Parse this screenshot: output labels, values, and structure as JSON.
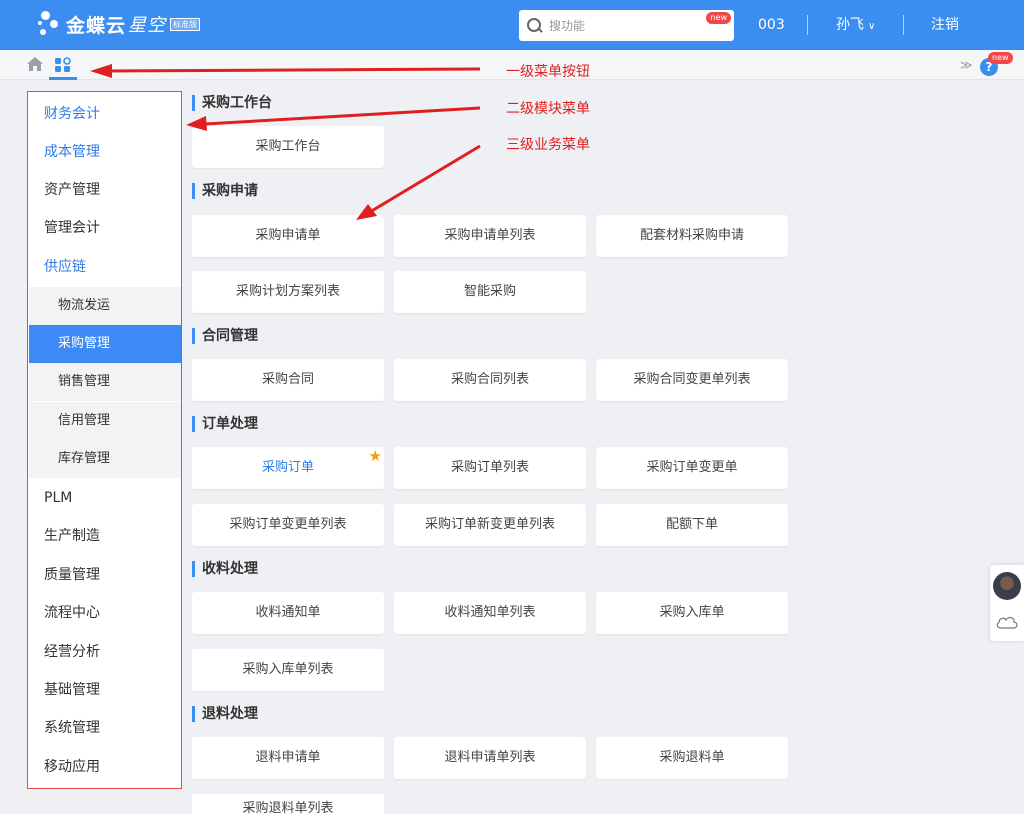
{
  "header": {
    "logo_text": "金蝶云",
    "logo_text2": "星空",
    "logo_badge": "标准版",
    "search_placeholder": "搜功能",
    "search_badge": "new",
    "org_code": "003",
    "user_name": "孙飞",
    "logout_label": "注销",
    "help_badge": "new",
    "help_label": "?"
  },
  "sidebar": {
    "items": [
      {
        "label": "财务会计",
        "active": true
      },
      {
        "label": "成本管理",
        "active": true
      },
      {
        "label": "资产管理"
      },
      {
        "label": "管理会计"
      },
      {
        "label": "供应链",
        "active": true
      },
      {
        "label": "物流发运",
        "sub": true
      },
      {
        "label": "采购管理",
        "sub": true,
        "selected": true
      },
      {
        "label": "销售管理",
        "sub": true
      },
      {
        "label": "信用管理",
        "sub": true
      },
      {
        "label": "库存管理",
        "sub": true
      },
      {
        "label": "PLM"
      },
      {
        "label": "生产制造"
      },
      {
        "label": "质量管理"
      },
      {
        "label": "流程中心"
      },
      {
        "label": "经营分析"
      },
      {
        "label": "基础管理"
      },
      {
        "label": "系统管理"
      },
      {
        "label": "移动应用"
      }
    ]
  },
  "sections": [
    {
      "title": "采购工作台",
      "cards": [
        "采购工作台"
      ]
    },
    {
      "title": "采购申请",
      "cards": [
        "采购申请单",
        "采购申请单列表",
        "配套材料采购申请",
        "采购计划方案列表",
        "智能采购"
      ]
    },
    {
      "title": "合同管理",
      "cards": [
        "采购合同",
        "采购合同列表",
        "采购合同变更单列表"
      ]
    },
    {
      "title": "订单处理",
      "cards": [
        "采购订单",
        "采购订单列表",
        "采购订单变更单",
        "采购订单变更单列表",
        "采购订单新变更单列表",
        "配额下单"
      ]
    },
    {
      "title": "收料处理",
      "cards": [
        "收料通知单",
        "收料通知单列表",
        "采购入库单",
        "采购入库单列表"
      ]
    },
    {
      "title": "退料处理",
      "cards": [
        "退料申请单",
        "退料申请单列表",
        "采购退料单",
        "采购退料单列表"
      ]
    }
  ],
  "annotations": {
    "level1": "一级菜单按钮",
    "level2": "二级模块菜单",
    "level3": "三级业务菜单"
  },
  "colors": {
    "header_bg": "#3b8ef0",
    "accent": "#2c7ce6",
    "selected_bg": "#3d8af7",
    "annotation": "#e02020",
    "star": "#f39c12"
  },
  "favorite_card": "采购订单"
}
